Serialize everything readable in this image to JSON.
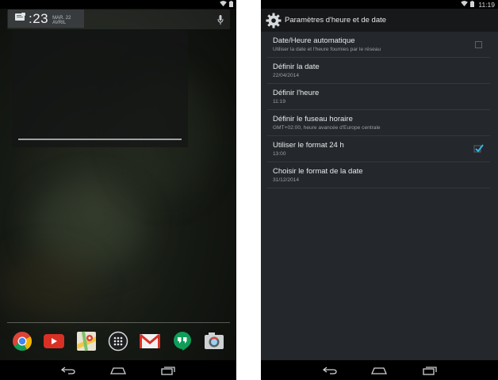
{
  "left_screen": {
    "status_bar": {
      "icons": [
        "wifi-icon",
        "battery-icon"
      ]
    },
    "clock_widget": {
      "time": ":23",
      "date": "MAR. 22 AVRIL"
    },
    "search": {
      "icon": "mic-icon"
    },
    "dock": {
      "apps": [
        {
          "name": "chrome-icon"
        },
        {
          "name": "youtube-icon"
        },
        {
          "name": "maps-icon"
        },
        {
          "name": "app-drawer-icon"
        },
        {
          "name": "gmail-icon"
        },
        {
          "name": "hangouts-icon"
        },
        {
          "name": "camera-icon"
        }
      ]
    }
  },
  "right_screen": {
    "status_bar": {
      "time": "11:19"
    },
    "action_bar": {
      "title": "Paramètres d'heure et de date",
      "icon": "settings-gear-icon"
    },
    "preferences": [
      {
        "title": "Date/Heure automatique",
        "summary": "Utiliser la date et l'heure fournies par le réseau",
        "control": "checkbox",
        "checked": false
      },
      {
        "title": "Définir la date",
        "summary": "22/04/2014"
      },
      {
        "title": "Définir l'heure",
        "summary": "11:19"
      },
      {
        "title": "Définir le fuseau horaire",
        "summary": "GMT+02:00, heure avancée d'Europe centrale"
      },
      {
        "title": "Utiliser le format 24 h",
        "summary": "13:00",
        "control": "checkbox",
        "checked": true
      },
      {
        "title": "Choisir le format de la date",
        "summary": "31/12/2014"
      }
    ]
  },
  "colors": {
    "accent": "#33b5e5",
    "settings_bg": "#24272b",
    "actionbar_bg": "#16181a"
  }
}
